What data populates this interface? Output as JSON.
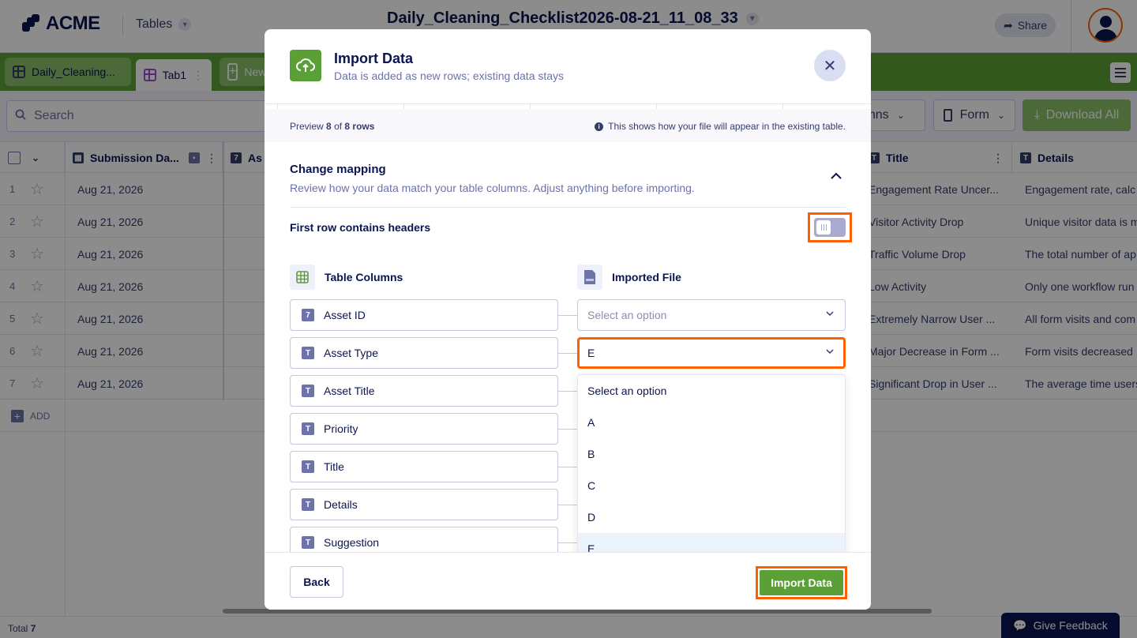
{
  "app": {
    "logo_text": "ACME",
    "section": "Tables",
    "doc_title": "Daily_Cleaning_Checklist2026-08-21_11_08_33",
    "share_label": "Share"
  },
  "tabs": [
    {
      "label": "Daily_Cleaning..."
    },
    {
      "label": "Tab1"
    },
    {
      "label": "New"
    }
  ],
  "toolbar": {
    "search_placeholder": "Search",
    "columns_label": "lumns",
    "form_label": "Form",
    "download_label": "Download All"
  },
  "table": {
    "headers": {
      "submission": "Submission Da...",
      "asset": "As",
      "title": "Title",
      "details": "Details"
    },
    "rows": [
      {
        "n": "1",
        "date": "Aug 21, 2026",
        "title": "Engagement Rate Uncer...",
        "details": "Engagement rate, calc"
      },
      {
        "n": "2",
        "date": "Aug 21, 2026",
        "title": "Visitor Activity Drop",
        "details": "Unique visitor data is m"
      },
      {
        "n": "3",
        "date": "Aug 21, 2026",
        "title": "Traffic Volume Drop",
        "details": "The total number of ap"
      },
      {
        "n": "4",
        "date": "Aug 21, 2026",
        "title": "Low Activity",
        "details": "Only one workflow run"
      },
      {
        "n": "5",
        "date": "Aug 21, 2026",
        "title": "Extremely Narrow User ...",
        "details": "All form visits and com"
      },
      {
        "n": "6",
        "date": "Aug 21, 2026",
        "title": "Major Decrease in Form ...",
        "details": "Form visits decreased"
      },
      {
        "n": "7",
        "date": "Aug 21, 2026",
        "title": "Significant Drop in User ...",
        "details": "The average time users"
      }
    ],
    "add_label": "ADD",
    "total_label": "Total",
    "total_value": "7"
  },
  "feedback_label": "Give Feedback",
  "modal": {
    "title": "Import Data",
    "subtitle": "Data is added as new rows; existing data stays",
    "preview_prefix": "Preview",
    "preview_shown": "8",
    "preview_of": "of",
    "preview_total": "8 rows",
    "preview_note": "This shows how your file will appear in the existing table.",
    "mapping_title": "Change mapping",
    "mapping_subtitle": "Review how your data match your table columns. Adjust anything before importing.",
    "headers_toggle_label": "First row contains headers",
    "headers_toggle_on": false,
    "table_columns_label": "Table Columns",
    "imported_file_label": "Imported File",
    "fields": [
      {
        "icon": "7",
        "label": "Asset ID",
        "mapped": "Select an option"
      },
      {
        "icon": "T",
        "label": "Asset Type",
        "mapped": "E"
      },
      {
        "icon": "T",
        "label": "Asset Title",
        "mapped": ""
      },
      {
        "icon": "T",
        "label": "Priority",
        "mapped": ""
      },
      {
        "icon": "T",
        "label": "Title",
        "mapped": ""
      },
      {
        "icon": "T",
        "label": "Details",
        "mapped": ""
      },
      {
        "icon": "T",
        "label": "Suggestion",
        "mapped": ""
      }
    ],
    "dropdown_options": [
      "Select an option",
      "A",
      "B",
      "C",
      "D",
      "E"
    ],
    "dropdown_selected": "E",
    "back_label": "Back",
    "import_label": "Import Data"
  },
  "colors": {
    "brand_green": "#5ba037",
    "highlight_orange": "#ff6100",
    "navy": "#0a1551"
  }
}
